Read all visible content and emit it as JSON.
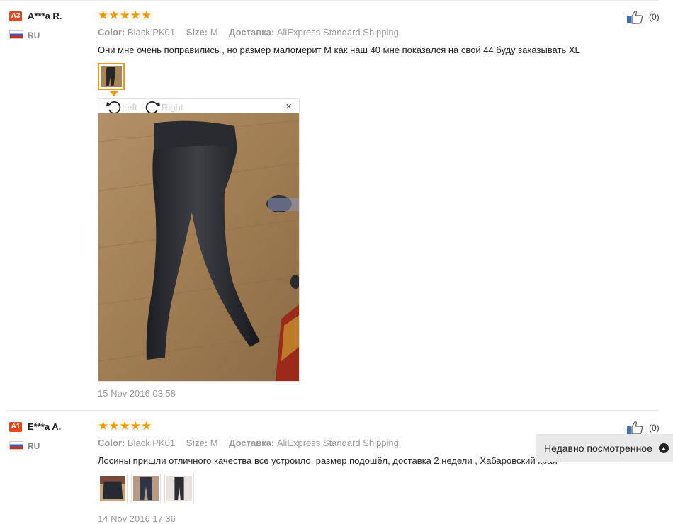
{
  "reviews": [
    {
      "badge": "A3",
      "name": "A***a R.",
      "country": "RU",
      "stars": "★★★★★",
      "color_label": "Color:",
      "color_value": "Black PK01",
      "size_label": "Size:",
      "size_value": "M",
      "shipping_label": "Доставка:",
      "shipping_value": "AliExpress Standard Shipping",
      "text": "Они мне очень поправились , но размер маломерит М как наш 40 мне показался на свой 44 буду заказывать XL",
      "date": "15 Nov 2016 03:58",
      "likes": "(0)",
      "viewer": {
        "rotate_left": "Left",
        "rotate_right": "Right",
        "close": "×"
      }
    },
    {
      "badge": "A1",
      "name": "E***a A.",
      "country": "RU",
      "stars": "★★★★★",
      "color_label": "Color:",
      "color_value": "Black PK01",
      "size_label": "Size:",
      "size_value": "M",
      "shipping_label": "Доставка:",
      "shipping_value": "AliExpress Standard Shipping",
      "text": "Лосины пришли отличного качества все устроило, размер подошёл, доставка 2 недели , Хабаровский край",
      "date": "14 Nov 2016 17:36",
      "likes": "(0)"
    }
  ],
  "recently_viewed": {
    "label": "Недавно посмотренное"
  },
  "colors": {
    "accent": "#f29b00",
    "badge": "#e0481f"
  },
  "icons": [
    "thumbs-up-icon",
    "rotate-left-icon",
    "rotate-right-icon",
    "close-icon",
    "chevron-up-icon",
    "star-icon"
  ]
}
